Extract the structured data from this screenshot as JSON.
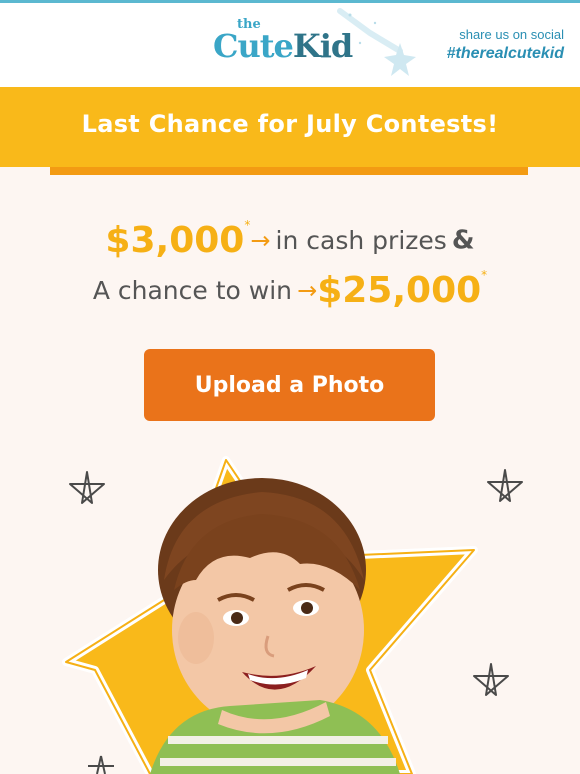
{
  "header": {
    "logo_the": "the",
    "logo_cute": "Cute",
    "logo_kid": "Kid",
    "social_line1": "share us on social",
    "social_hashtag": "#therealcutekid"
  },
  "banner": {
    "title": "Last Chance for July Contests!"
  },
  "promo": {
    "cash_amount": "$3,000",
    "cash_asterisk": "*",
    "cash_arrow": "→",
    "cash_text": "in cash prizes",
    "ampersand": "&",
    "chance_text": "A chance to win",
    "chance_arrow": "→",
    "chance_amount": "$25,000",
    "chance_asterisk": "*"
  },
  "cta": {
    "label": "Upload a Photo"
  },
  "colors": {
    "brand_blue": "#3aa6c7",
    "banner_yellow": "#f9b91a",
    "cta_orange": "#ea731a",
    "prize_gold": "#f6b015",
    "background": "#fdf6f2"
  }
}
